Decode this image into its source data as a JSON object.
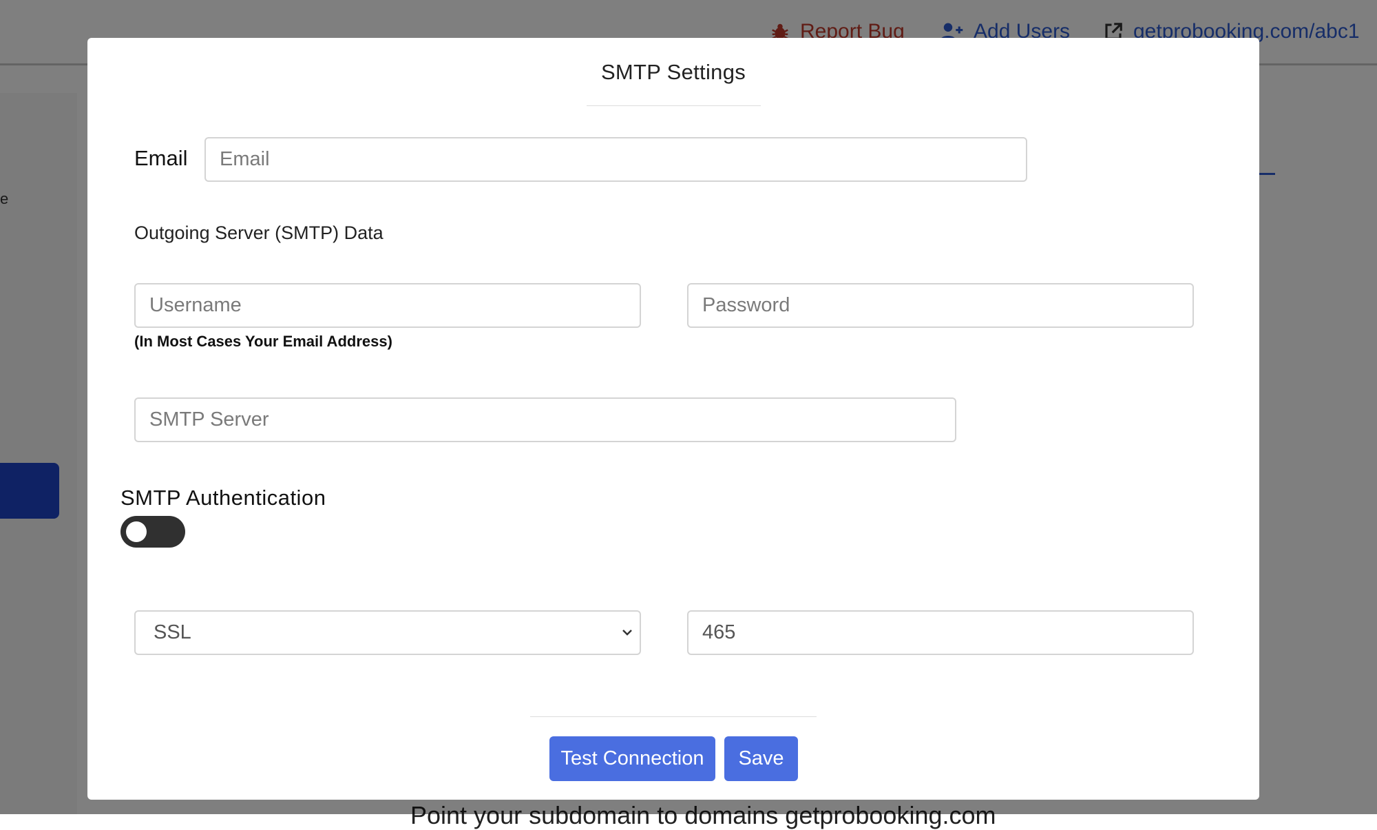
{
  "background": {
    "topbar": {
      "report_bug": "Report Bug",
      "add_users": "Add Users",
      "site_link": "getprobooking.com/abc1"
    },
    "footer_text": "Point your subdomain to domains getprobooking.com",
    "edge_mark": "e"
  },
  "modal": {
    "title": "SMTP Settings",
    "email": {
      "label": "Email",
      "placeholder": "Email",
      "value": ""
    },
    "outgoing_section_label": "Outgoing Server (SMTP) Data",
    "username": {
      "placeholder": "Username",
      "value": ""
    },
    "username_hint": "(In Most Cases Your Email Address)",
    "password": {
      "placeholder": "Password",
      "value": ""
    },
    "smtp_server": {
      "placeholder": "SMTP Server",
      "value": ""
    },
    "smtp_authentication": {
      "label": "SMTP Authentication",
      "enabled": false
    },
    "encryption": {
      "selected": "SSL"
    },
    "port": {
      "value": "465"
    },
    "buttons": {
      "test_connection": "Test Connection",
      "save": "Save"
    }
  },
  "colors": {
    "primary_button": "#4a6ee0",
    "report_bug": "#c0392b",
    "link": "#2d5bd1",
    "toggle_off": "#303030"
  }
}
